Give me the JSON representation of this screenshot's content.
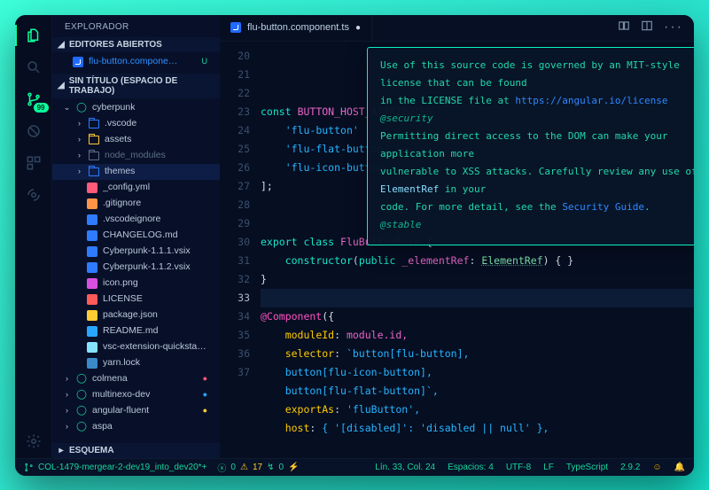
{
  "sidebar": {
    "title": "EXPLORADOR",
    "openEditors": {
      "label": "EDITORES ABIERTOS"
    },
    "openFile": {
      "name": "flu-button.compone…",
      "modified": "U"
    },
    "workspace": {
      "label": "SIN TÍTULO (ESPACIO DE TRABAJO)"
    },
    "tree": {
      "root": "cyberpunk",
      "folders": [
        {
          "name": ".vscode",
          "dim": false
        },
        {
          "name": "assets",
          "dim": false
        },
        {
          "name": "node_modules",
          "dim": true
        },
        {
          "name": "themes",
          "dim": false,
          "selected": true
        }
      ],
      "files": [
        {
          "name": "_config.yml",
          "color": "#ff5a7a",
          "icon": "braces"
        },
        {
          "name": ".gitignore",
          "color": "#ff9447",
          "icon": "git"
        },
        {
          "name": ".vscodeignore",
          "color": "#2f7bff",
          "icon": "vsc"
        },
        {
          "name": "CHANGELOG.md",
          "color": "#2f7bff",
          "icon": "vsc"
        },
        {
          "name": "Cyberpunk-1.1.1.vsix",
          "color": "#2f7bff",
          "icon": "vsc"
        },
        {
          "name": "Cyberpunk-1.1.2.vsix",
          "color": "#2f7bff",
          "icon": "vsc"
        },
        {
          "name": "icon.png",
          "color": "#d94fe0",
          "icon": "img"
        },
        {
          "name": "LICENSE",
          "color": "#ff5a5a",
          "icon": "doc"
        },
        {
          "name": "package.json",
          "color": "#ffcc33",
          "icon": "braces"
        },
        {
          "name": "README.md",
          "color": "#29a6ff",
          "icon": "info"
        },
        {
          "name": "vsc-extension-quicksta…",
          "color": "#86e1ff",
          "icon": "md"
        },
        {
          "name": "yarn.lock",
          "color": "#3a89c9",
          "icon": "lock"
        }
      ],
      "siblings": [
        {
          "name": "colmena",
          "badge": "●",
          "badgeColor": "#ff5a7a"
        },
        {
          "name": "multinexo-dev",
          "badge": "●",
          "badgeColor": "#29a6ff"
        },
        {
          "name": "angular-fluent",
          "badge": "●",
          "badgeColor": "#ffcc33"
        },
        {
          "name": "aspa",
          "badge": "",
          "badgeColor": ""
        }
      ]
    },
    "outline": "ESQUEMA"
  },
  "tab": {
    "label": "flu-button.component.ts",
    "dirty": "●"
  },
  "gutter": {
    "start": 20,
    "end": 37,
    "highlight": 33
  },
  "code": {
    "l20": {
      "kw": "const",
      "id": "BUTTON_HOST_ATTRIBUTES"
    },
    "l21": "'flu-button'",
    "l22": "'flu-flat-button'",
    "l23": "'flu-icon-button'",
    "l24": "];",
    "l27": {
      "kw": "export class",
      "id": "FluButtonBase",
      "trail": " { "
    },
    "l28": {
      "ctor": "constructor",
      "mod": "public",
      "arg": "_elementRef",
      "type": "ElementRef",
      "tail": ") { }"
    },
    "l29": "}",
    "l31": {
      "at": "@Component",
      "open": "({"
    },
    "l32": {
      "k": "moduleId",
      "v": "module.id,"
    },
    "l33": {
      "k": "selector",
      "v": "`button[flu-button],"
    },
    "l34": "button[flu-icon-button],",
    "l35": "button[flu-flat-button]`,",
    "l36": {
      "k": "exportAs",
      "v": "'fluButton',"
    },
    "l37": {
      "k": "host",
      "v": "{ '[disabled]': 'disabled || null' },"
    }
  },
  "hover": {
    "p1a": "Use of this source code is governed by an MIT-style license that can be found",
    "p1b": "in the LICENSE file at ",
    "link1": "https://angular.io/license",
    "tag1": "@security",
    "p2a": "Permitting direct access to the DOM can make your application more",
    "p2b": "vulnerable to XSS attacks. Carefully review any use of ",
    "code": "ElementRef",
    "p2c": " in your",
    "p2d": "code. For more detail, see the ",
    "link2": "Security Guide",
    "p2e": ".",
    "tag2": "@stable"
  },
  "status": {
    "branch": "COL-1479-mergear-2-dev19_into_dev20*+",
    "errors": "0",
    "warnings": "17",
    "sync": "0",
    "pos": "Lín. 33, Col. 24",
    "spaces": "Espacios: 4",
    "enc": "UTF-8",
    "eol": "LF",
    "lang": "TypeScript",
    "ver": "2.9.2"
  },
  "scm_badge": "99"
}
